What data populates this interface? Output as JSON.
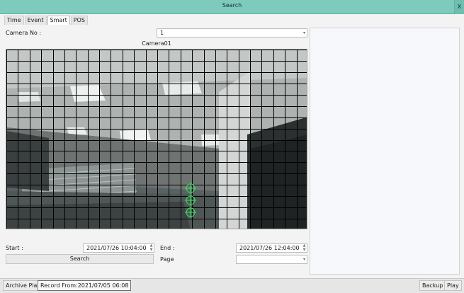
{
  "window": {
    "title": "Search",
    "close_label": "X"
  },
  "tabs": [
    {
      "label": "Time"
    },
    {
      "label": "Event"
    },
    {
      "label": "Smart"
    },
    {
      "label": "POS"
    }
  ],
  "camera": {
    "label": "Camera No :",
    "value": "1",
    "name": "Camera01"
  },
  "start": {
    "label": "Start :",
    "value": "2021/07/26 10:04:00"
  },
  "end": {
    "label": "End :",
    "value": "2021/07/26 12:04:00"
  },
  "page": {
    "label": "Page",
    "value": ""
  },
  "search_button": "Search",
  "status": {
    "archive_play": "Archive Play",
    "record_from": "Record From:2021/07/05 06:08",
    "backup": "Backup",
    "play": "Play"
  },
  "colors": {
    "titlebar": "#7ecbbd",
    "grid_line": "#000000",
    "motion_marker": "#39d65a"
  },
  "icons": {
    "close": "close-icon",
    "motion": "motion-marker-icon"
  }
}
